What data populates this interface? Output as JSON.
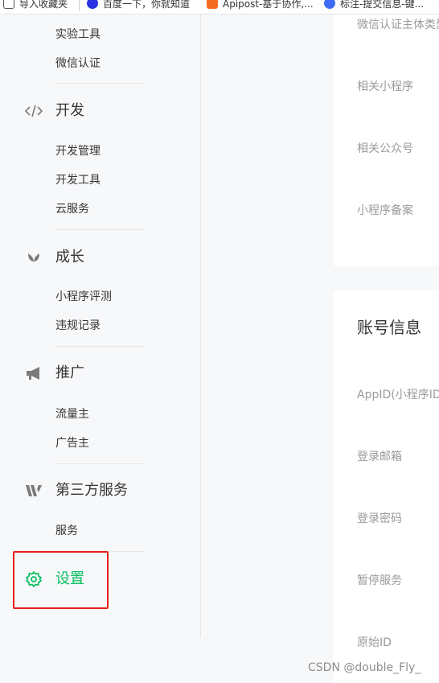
{
  "bookmarks": [
    {
      "label": "导入收藏夹",
      "icon": "import-icon"
    },
    {
      "label": "百度一下，你就知道",
      "icon": "baidu-icon"
    },
    {
      "label": "Apipost-基于协作,...",
      "icon": "apipost-icon"
    },
    {
      "label": "标注-提交信息-键...",
      "icon": "label-icon"
    }
  ],
  "sidebar": {
    "top_items": [
      "实验工具",
      "微信认证"
    ],
    "groups": [
      {
        "title": "开发",
        "icon": "code-icon",
        "items": [
          "开发管理",
          "开发工具",
          "云服务"
        ]
      },
      {
        "title": "成长",
        "icon": "sprout-icon",
        "items": [
          "小程序评测",
          "违规记录"
        ]
      },
      {
        "title": "推广",
        "icon": "megaphone-icon",
        "items": [
          "流量主",
          "广告主"
        ]
      },
      {
        "title": "第三方服务",
        "icon": "third-party-icon",
        "items": [
          "服务"
        ]
      }
    ],
    "settings": {
      "title": "设置",
      "icon": "gear-icon",
      "color": "#07c160"
    }
  },
  "main": {
    "card1_labels": [
      "微信认证主体类型",
      "相关小程序",
      "相关公众号",
      "小程序备案"
    ],
    "account_section": {
      "title": "账号信息",
      "labels": [
        "AppID(小程序ID)",
        "登录邮箱",
        "登录密码",
        "暂停服务",
        "原始ID"
      ]
    }
  },
  "watermark": "CSDN @double_Fly_",
  "colors": {
    "accent": "#07c160",
    "highlight": "#e5201d"
  }
}
